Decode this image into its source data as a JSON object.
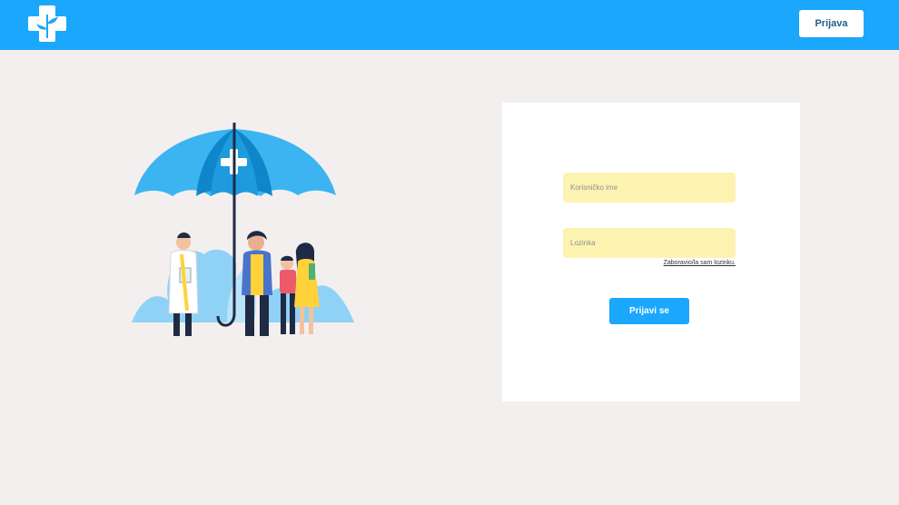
{
  "header": {
    "logo_icon": "medical-cross-leaf-logo-icon",
    "login_button_label": "Prijava"
  },
  "illustration": {
    "icon": "family-umbrella-insurance-illustration"
  },
  "login_form": {
    "username": {
      "placeholder": "Korisničko ime",
      "value": ""
    },
    "password": {
      "placeholder": "Lozinka",
      "value": ""
    },
    "forgot_password_link": "Zaboravio/la sam lozinku.",
    "submit_label": "Prijavi se"
  },
  "colors": {
    "brand_blue": "#1ba7fc",
    "background": "#f3efef",
    "input_fill": "#fdf3b1",
    "card": "#ffffff"
  }
}
